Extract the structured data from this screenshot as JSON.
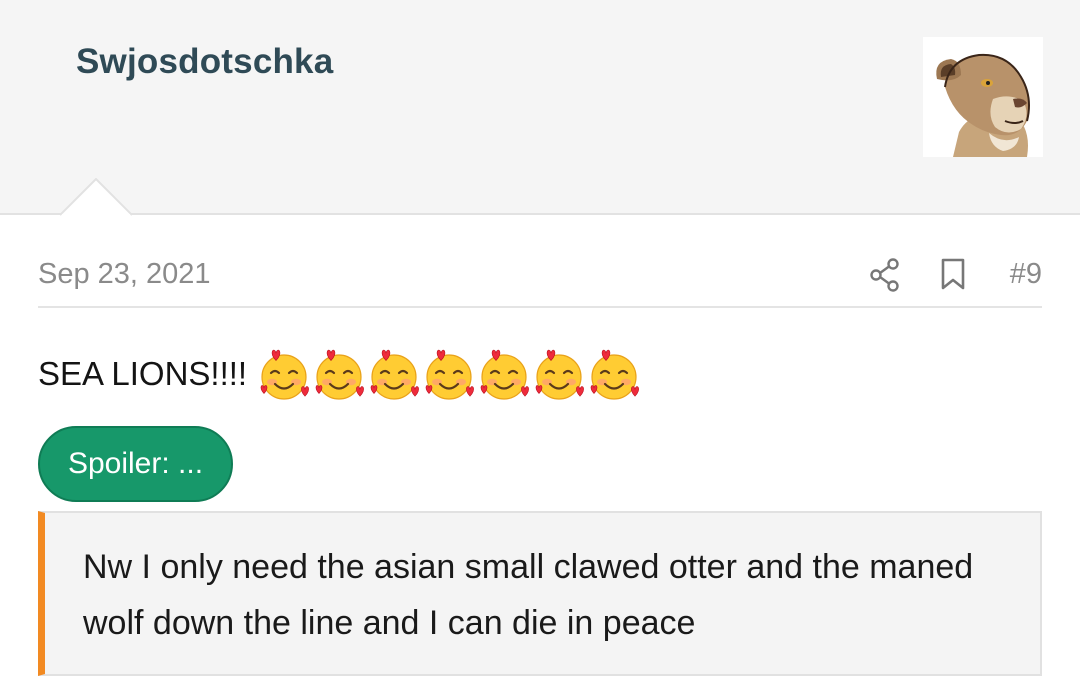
{
  "post": {
    "username": "Swjosdotschka",
    "date": "Sep 23, 2021",
    "post_number": "#9",
    "message": "SEA LIONS!!!!",
    "emoji_count": 7,
    "emoji_name": "smiling-face-with-hearts",
    "spoiler_label": "Spoiler: ...",
    "quote_text": "Nw I only need the asian small clawed otter and the maned wolf down the line and I can die in peace"
  },
  "icons": {
    "share": "share-icon",
    "bookmark": "bookmark-icon",
    "avatar": "lioness-avatar"
  },
  "colors": {
    "username": "#2f4a56",
    "spoiler_bg": "#17986a",
    "quote_accent": "#f28a22",
    "header_bg": "#f5f5f5"
  }
}
